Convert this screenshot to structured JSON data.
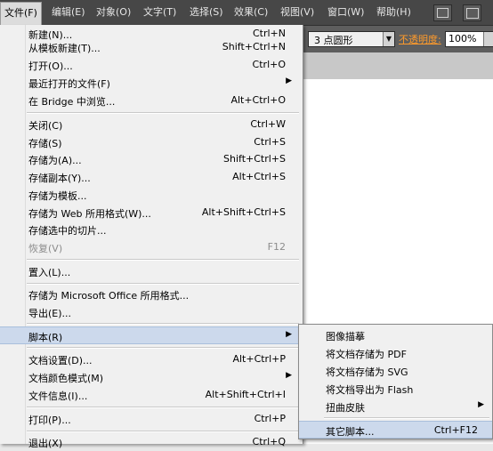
{
  "menubar": {
    "items": [
      {
        "label": "文件(F)"
      },
      {
        "label": "编辑(E)"
      },
      {
        "label": "对象(O)"
      },
      {
        "label": "文字(T)"
      },
      {
        "label": "选择(S)"
      },
      {
        "label": "效果(C)"
      },
      {
        "label": "视图(V)"
      },
      {
        "label": "窗口(W)"
      },
      {
        "label": "帮助(H)"
      }
    ],
    "icons": [
      "bridge-icon",
      "arrange-documents-icon"
    ]
  },
  "controlbar": {
    "brush_value": "3 点圆形",
    "opacity_label": "不透明度:",
    "opacity_value": "100%"
  },
  "file_menu": {
    "items": [
      {
        "label": "新建(N)...",
        "shortcut": "Ctrl+N"
      },
      {
        "label": "从模板新建(T)...",
        "shortcut": "Shift+Ctrl+N"
      },
      {
        "label": "打开(O)...",
        "shortcut": "Ctrl+O"
      },
      {
        "label": "最近打开的文件(F)",
        "shortcut": ""
      },
      {
        "label": "在 Bridge 中浏览...",
        "shortcut": "Alt+Ctrl+O"
      },
      {
        "label": "关闭(C)",
        "shortcut": "Ctrl+W"
      },
      {
        "label": "存储(S)",
        "shortcut": "Ctrl+S"
      },
      {
        "label": "存储为(A)...",
        "shortcut": "Shift+Ctrl+S"
      },
      {
        "label": "存储副本(Y)...",
        "shortcut": "Alt+Ctrl+S"
      },
      {
        "label": "存储为模板...",
        "shortcut": ""
      },
      {
        "label": "存储为 Web 所用格式(W)...",
        "shortcut": "Alt+Shift+Ctrl+S"
      },
      {
        "label": "存储选中的切片...",
        "shortcut": ""
      },
      {
        "label": "恢复(V)",
        "shortcut": "F12"
      },
      {
        "label": "置入(L)...",
        "shortcut": ""
      },
      {
        "label": "存储为 Microsoft Office 所用格式...",
        "shortcut": ""
      },
      {
        "label": "导出(E)...",
        "shortcut": ""
      },
      {
        "label": "脚本(R)",
        "shortcut": ""
      },
      {
        "label": "文档设置(D)...",
        "shortcut": "Alt+Ctrl+P"
      },
      {
        "label": "文档颜色模式(M)",
        "shortcut": ""
      },
      {
        "label": "文件信息(I)...",
        "shortcut": "Alt+Shift+Ctrl+I"
      },
      {
        "label": "打印(P)...",
        "shortcut": "Ctrl+P"
      },
      {
        "label": "退出(X)",
        "shortcut": "Ctrl+Q"
      }
    ]
  },
  "scripts_submenu": {
    "items": [
      {
        "label": "图像描摹",
        "shortcut": ""
      },
      {
        "label": "将文档存储为 PDF",
        "shortcut": ""
      },
      {
        "label": "将文档存储为 SVG",
        "shortcut": ""
      },
      {
        "label": "将文档导出为 Flash",
        "shortcut": ""
      },
      {
        "label": "扭曲皮肤",
        "shortcut": ""
      },
      {
        "label": "其它脚本...",
        "shortcut": "Ctrl+F12"
      }
    ]
  },
  "colors": {
    "menubar_bg": "#474747",
    "menu_bg": "#f0f0f0",
    "highlight": "#ccd9ec",
    "opacity_label": "#ff9b2b"
  }
}
